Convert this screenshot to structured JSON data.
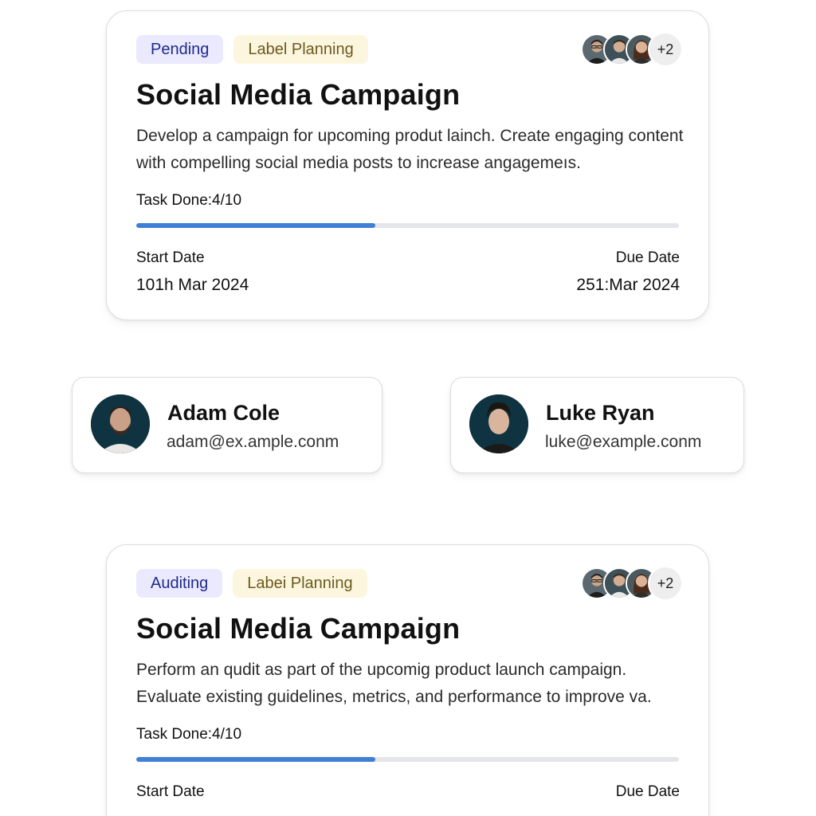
{
  "task_cards": [
    {
      "status": "Pending",
      "label": "Label  Planning",
      "extra_members": "+2",
      "title": "Social Media Campaign",
      "description": "Develop a campaign for upcoming produt lainch. Create engaging content with compelling social media posts to increase angagemeıs.",
      "task_done": "Task Done:4/10",
      "progress": 0.44,
      "start_label": "Start Date",
      "start_value": "101h Mar 2024",
      "due_label": "Due Date",
      "due_value": "251:Mar 2024"
    },
    {
      "status": "Auditing",
      "label": "Labei  Planning",
      "extra_members": "+2",
      "title": "Social Media Campaign",
      "description": "Perform an qudit as part of the upcomig product launch campaign. Evaluate existing guidelines, metrics, and performance to improve va.",
      "task_done": "Task Done:4/10",
      "progress": 0.44,
      "start_label": "Start Date",
      "due_label": "Due Date"
    }
  ],
  "contacts": [
    {
      "name": "Adam Cole",
      "email": "adam@ex.ample.conm"
    },
    {
      "name": "Luke Ryan",
      "email": "luke@example.conm"
    }
  ],
  "colors": {
    "status_bg": "#ebe9fd",
    "status_text": "#1e2a8c",
    "label_bg": "#fdf6df",
    "label_text": "#6b5a1e",
    "progress_fill": "#3f7fd6",
    "progress_track": "#e4e6ea",
    "avatar_bg": "#0f3340"
  }
}
